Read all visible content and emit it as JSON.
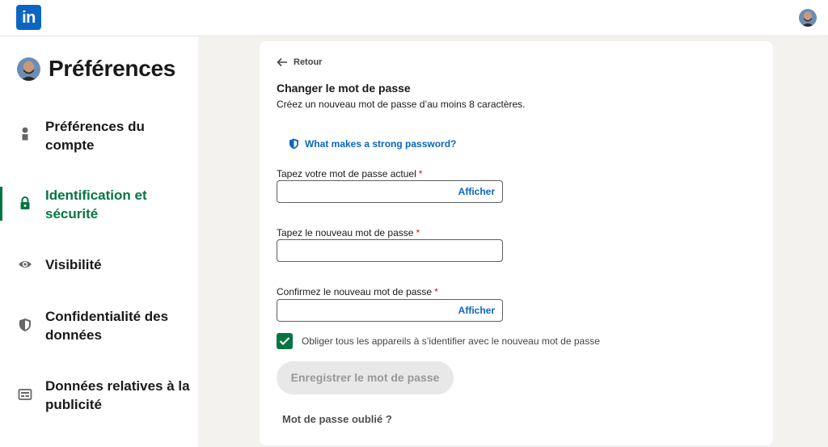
{
  "topbar": {
    "logo_text": "in",
    "logo_icon": "linkedin-logo",
    "avatar_icon": "user-avatar"
  },
  "sidebar": {
    "title": "Préférences",
    "items": [
      {
        "label": "Préférences du compte",
        "icon": "person-icon",
        "active": false
      },
      {
        "label": "Identification et sécurité",
        "icon": "lock-icon",
        "active": true
      },
      {
        "label": "Visibilité",
        "icon": "eye-icon",
        "active": false
      },
      {
        "label": "Confidentialité des données",
        "icon": "shield-icon",
        "active": false
      },
      {
        "label": "Données relatives à la publicité",
        "icon": "ad-card-icon",
        "active": false
      }
    ]
  },
  "form": {
    "back_label": "Retour",
    "title": "Changer le mot de passe",
    "subtitle": "Créez un nouveau mot de passe d’au moins 8 caractères.",
    "strong_link": "What makes a strong password?",
    "fields": [
      {
        "label": "Tapez votre mot de passe actuel",
        "required_mark": "*",
        "value": "",
        "show_label": "Afficher"
      },
      {
        "label": "Tapez le nouveau mot de passe",
        "required_mark": "*",
        "value": ""
      },
      {
        "label": "Confirmez le nouveau mot de passe",
        "required_mark": "*",
        "value": "",
        "show_label": "Afficher"
      }
    ],
    "checkbox_label": "Obliger tous les appareils à s’identifier avec le nouveau mot de passe",
    "checkbox_checked": true,
    "save_label": "Enregistrer le mot de passe",
    "forgot_label": "Mot de passe oublié ?"
  },
  "colors": {
    "brand": "#0a66c2",
    "active_green": "#057642",
    "background": "#f4f2ee"
  }
}
